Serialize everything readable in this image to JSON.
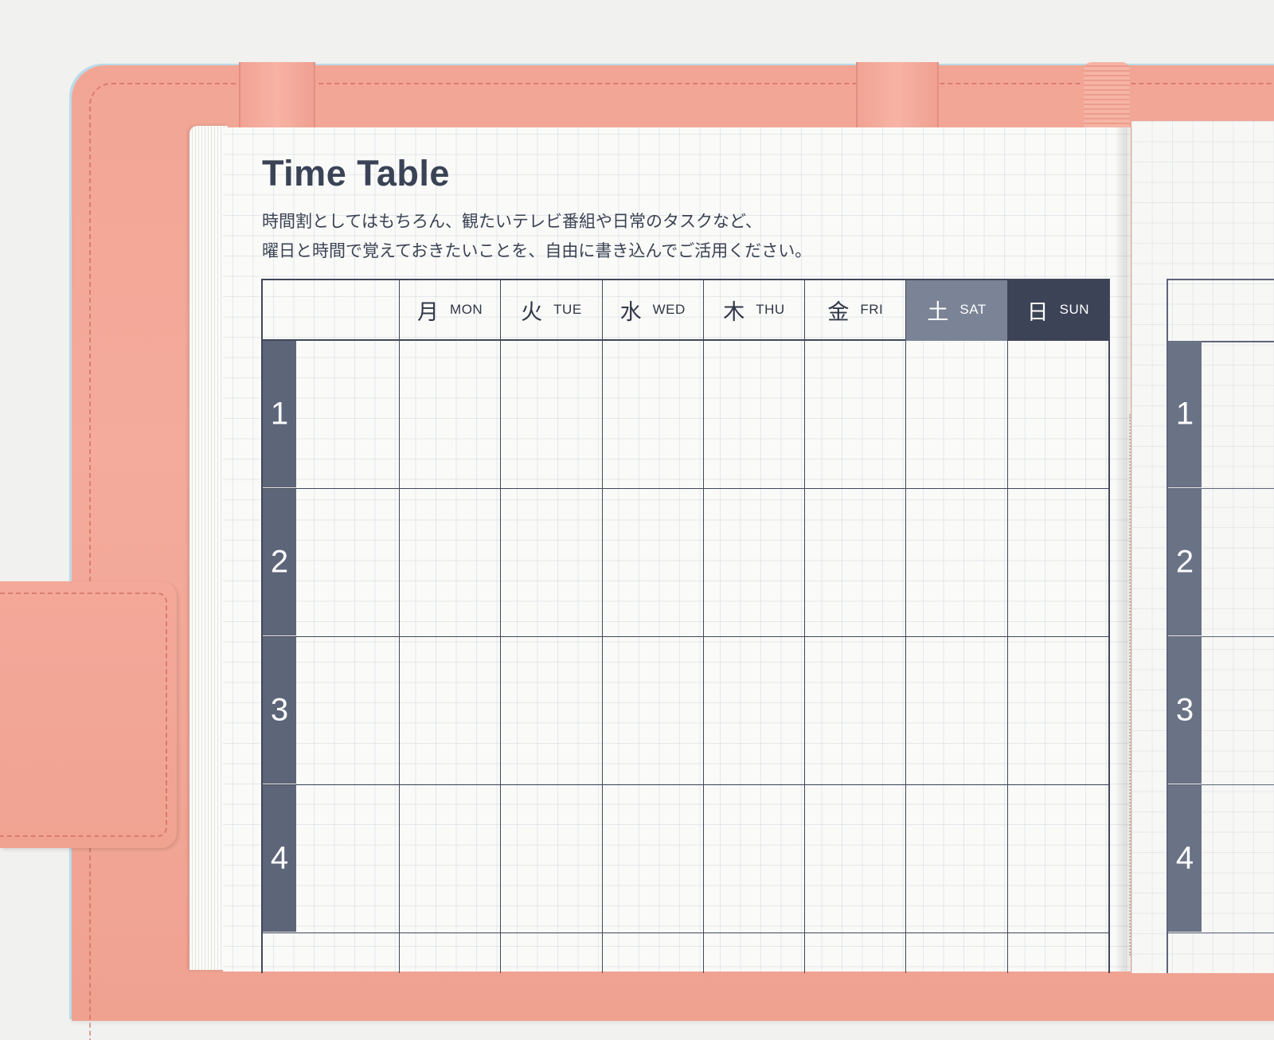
{
  "timetable": {
    "title": "Time Table",
    "description": [
      "時間割としてはもちろん、観たいテレビ番組や日常のタスクなど、",
      "曜日と時間で覚えておきたいことを、自由に書き込んでご活用ください。"
    ],
    "days": [
      {
        "kanji": "月",
        "en": "MON"
      },
      {
        "kanji": "火",
        "en": "TUE"
      },
      {
        "kanji": "水",
        "en": "WED"
      },
      {
        "kanji": "木",
        "en": "THU"
      },
      {
        "kanji": "金",
        "en": "FRI"
      },
      {
        "kanji": "土",
        "en": "SAT"
      },
      {
        "kanji": "日",
        "en": "SUN"
      }
    ],
    "periods": [
      "1",
      "2",
      "3",
      "4"
    ]
  },
  "right_page": {
    "periods": [
      "1",
      "2",
      "3",
      "4"
    ]
  },
  "colors": {
    "cover": "#f2a595",
    "ink": "#3f4759",
    "saturday_header": "#7b8496",
    "sunday_header": "#3c4356",
    "period_bar": "#5d6579",
    "paper": "#fafaf8"
  }
}
